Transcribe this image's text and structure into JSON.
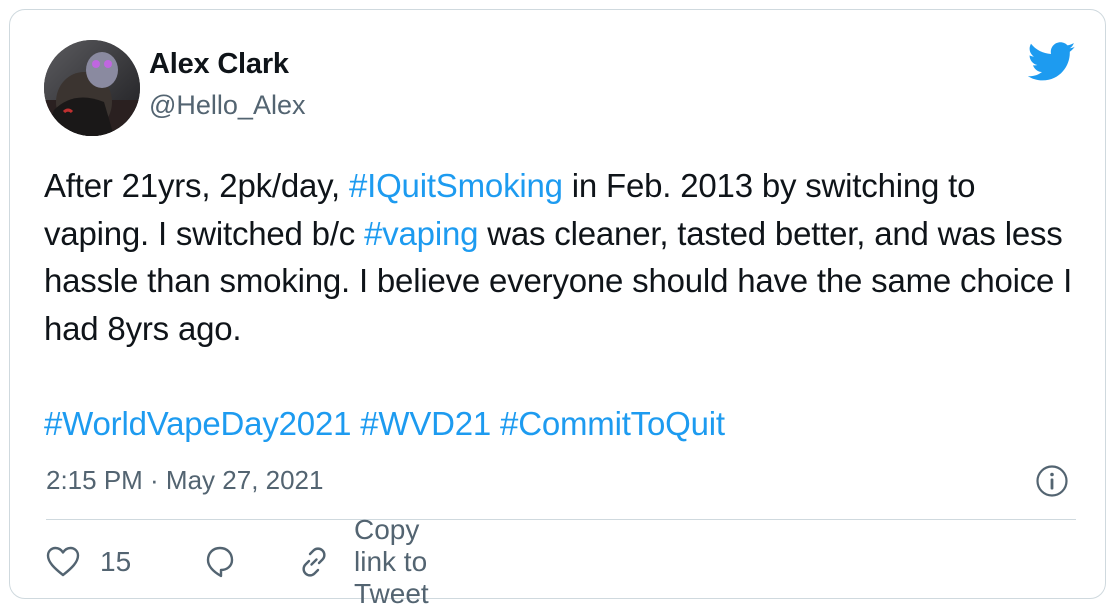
{
  "tweet": {
    "author_name": "Alex Clark",
    "author_handle": "@Hello_Alex",
    "text_parts": [
      {
        "text": "After 21yrs, 2pk/day, ",
        "type": "text"
      },
      {
        "text": "#IQuitSmoking",
        "type": "hashtag"
      },
      {
        "text": " in Feb. 2013 by switching to vaping. I switched b/c ",
        "type": "text"
      },
      {
        "text": "#vaping",
        "type": "hashtag"
      },
      {
        "text": " was cleaner, tasted better, and was less hassle than smoking. I believe everyone should have the same choice I had 8yrs ago.",
        "type": "text"
      }
    ],
    "hashtag_line": [
      "#WorldVapeDay2021",
      "#WVD21",
      "#CommitToQuit"
    ],
    "timestamp": "2:15 PM · May 27, 2021",
    "like_count": "15",
    "copy_link_label": "Copy link to Tweet"
  },
  "icons": {
    "brand": "twitter-bird-icon",
    "info": "info-icon",
    "like": "heart-icon",
    "reply": "reply-bubble-icon",
    "link": "link-icon"
  },
  "colors": {
    "brand": "#1d9bf0",
    "text": "#0f1419",
    "muted": "#536471",
    "border": "#cfd9de"
  }
}
